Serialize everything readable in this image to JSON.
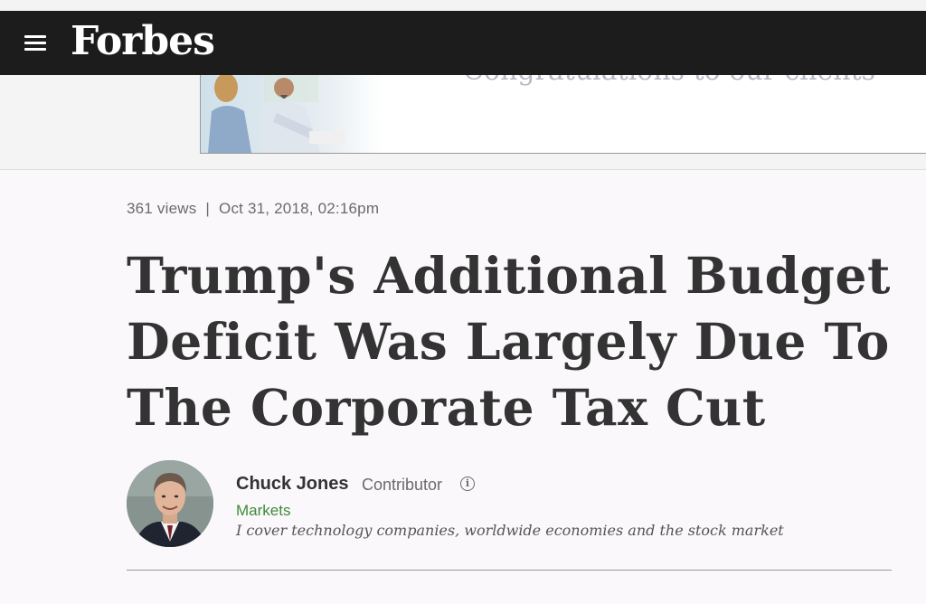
{
  "header": {
    "logo": "Forbes",
    "menu_icon": "hamburger-menu-icon"
  },
  "ad": {
    "text": "Congratulations to our clients"
  },
  "article": {
    "views": "361 views",
    "separator": "|",
    "date": "Oct 31, 2018, 02:16pm",
    "headline": "Trump's Additional Budget Deficit Was Largely Due To The Corporate Tax Cut"
  },
  "author": {
    "name": "Chuck Jones",
    "role": "Contributor",
    "info_icon": "info-icon",
    "channel": "Markets",
    "bio": "I cover technology companies, worldwide economies and the stock market"
  },
  "colors": {
    "header_bg": "#1c1c1c",
    "channel_green": "#3f8a3a",
    "text": "#333333"
  }
}
